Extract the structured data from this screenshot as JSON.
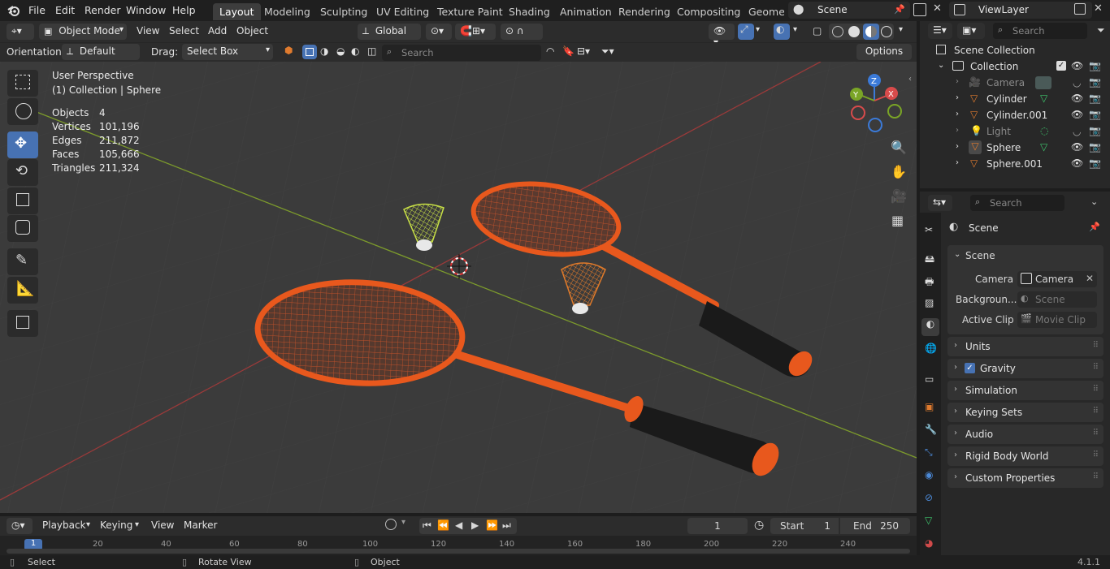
{
  "menu": [
    "File",
    "Edit",
    "Render",
    "Window",
    "Help"
  ],
  "workspaces": [
    "Layout",
    "Modeling",
    "Sculpting",
    "UV Editing",
    "Texture Paint",
    "Shading",
    "Animation",
    "Rendering",
    "Compositing",
    "Geomet"
  ],
  "scene_name": "Scene",
  "view_layer": "ViewLayer",
  "viewport_header": {
    "mode": "Object Mode",
    "view": "View",
    "select": "Select",
    "add": "Add",
    "object": "Object",
    "transform": "Global"
  },
  "tool_settings": {
    "orientation_label": "Orientation:",
    "orientation_value": "Default",
    "drag_label": "Drag:",
    "drag_value": "Select Box",
    "search_placeholder": "Search",
    "options": "Options"
  },
  "viewport_info": {
    "perspective": "User Perspective",
    "context": "(1) Collection | Sphere",
    "stats": [
      {
        "label": "Objects",
        "value": "4"
      },
      {
        "label": "Vertices",
        "value": "101,196"
      },
      {
        "label": "Edges",
        "value": "211,872"
      },
      {
        "label": "Faces",
        "value": "105,666"
      },
      {
        "label": "Triangles",
        "value": "211,324"
      }
    ]
  },
  "gizmo": {
    "x": "X",
    "y": "Y",
    "z": "Z"
  },
  "outliner": {
    "search_placeholder": "Search",
    "scene_collection": "Scene Collection",
    "collection": "Collection",
    "items": [
      {
        "name": "Camera",
        "dim": true
      },
      {
        "name": "Cylinder",
        "dim": false
      },
      {
        "name": "Cylinder.001",
        "dim": false
      },
      {
        "name": "Light",
        "dim": true
      },
      {
        "name": "Sphere",
        "dim": false
      },
      {
        "name": "Sphere.001",
        "dim": false
      }
    ]
  },
  "properties": {
    "search_placeholder": "Search",
    "context": "Scene",
    "scene_panel": "Scene",
    "camera_label": "Camera",
    "camera_value": "Camera",
    "background_label": "Backgroun...",
    "background_value": "Scene",
    "clip_label": "Active Clip",
    "clip_value": "Movie Clip",
    "panels": [
      "Units",
      "Gravity",
      "Simulation",
      "Keying Sets",
      "Audio",
      "Rigid Body World",
      "Custom Properties"
    ]
  },
  "timeline": {
    "playback": "Playback",
    "keying": "Keying",
    "view": "View",
    "marker": "Marker",
    "current_frame": "1",
    "start_label": "Start",
    "start_value": "1",
    "end_label": "End",
    "end_value": "250",
    "ruler": [
      "1",
      "20",
      "40",
      "60",
      "80",
      "100",
      "120",
      "140",
      "160",
      "180",
      "200",
      "220",
      "240"
    ]
  },
  "statusbar": {
    "select": "Select",
    "rotate": "Rotate View",
    "object": "Object",
    "version": "4.1.1"
  },
  "colors": {
    "accent": "#4772b3",
    "racket": "#e8581d",
    "shuttle_green": "#c8e046",
    "shuttle_orange": "#e07a2a"
  }
}
